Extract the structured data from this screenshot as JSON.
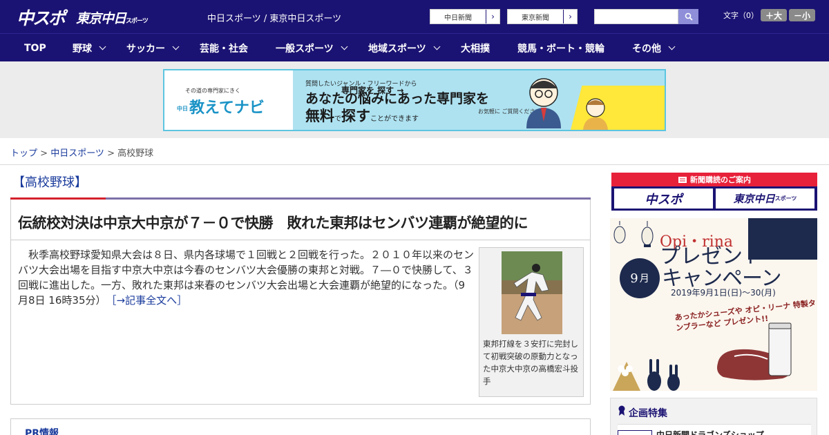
{
  "header": {
    "logo_chuspo": "中スポ",
    "logo_tokyo": "東京中日",
    "logo_tokyo_sub": "スポーツ",
    "site_title": "中日スポーツ / 東京中日スポーツ",
    "links": [
      {
        "label": "中日新聞"
      },
      {
        "label": "東京新聞"
      }
    ],
    "search": {
      "value": "",
      "placeholder": ""
    },
    "font_size_label": "文字（0）",
    "font_larger": "＋大",
    "font_smaller": "－小"
  },
  "nav": {
    "items": [
      {
        "label": "TOP"
      },
      {
        "label": "野球"
      },
      {
        "label": "サッカー"
      },
      {
        "label": "芸能・社会"
      },
      {
        "label": "一般スポーツ"
      },
      {
        "label": "地域スポーツ"
      },
      {
        "label": "大相撲"
      },
      {
        "label": "競馬・ボート・競輪"
      },
      {
        "label": "その他"
      }
    ]
  },
  "ad": {
    "sub": "その道の専門家にきく",
    "brand_prefix": "中日",
    "brand": "教えてナビ",
    "line1": "質問したいジャンル・フリーワードから",
    "line2": "あなたの悩みにあった専門家を",
    "line3_a": "無料",
    "line3_b": "で",
    "line3_c": "探す",
    "line3_d": "ことができます",
    "note": "お気軽に ご質問ください！",
    "cta": "専門家を 探す →"
  },
  "breadcrumb": {
    "home": "トップ",
    "sep": " > ",
    "section": "中日スポーツ",
    "current": "高校野球"
  },
  "article": {
    "section_title": "【高校野球】",
    "headline": "伝統校対決は中京大中京が７－０で快勝　敗れた東邦はセンバツ連覇が絶望的に",
    "lead": "秋季高校野球愛知県大会は８日、県内各球場で１回戦と２回戦を行った。２０１０年以来のセンバツ大会出場を目指す中京大中京は今春のセンバツ大会優勝の東邦と対戦。７―０で快勝して、３回戦に進出した。一方、敗れた東邦は来春のセンバツ大会出場と大会連覇が絶望的になった。（9月8日 16時35分）",
    "more_link": "［→記事全文へ］",
    "photo_caption": "東邦打線を３安打に完封して初戦突破の原動力となった中京大中京の高橋宏斗投手",
    "pr_label": "PR情報"
  },
  "sidebar": {
    "subscribe_title": "新聞購読のご案内",
    "subscribe_left": "中スポ",
    "subscribe_right": "東京中日",
    "subscribe_right_sub": "スポーツ",
    "promo": {
      "brand": "Opi・rina",
      "title1": "プレゼント",
      "title2": "キャンペーン",
      "month_num": "9",
      "month_unit": "月",
      "dates": "2019年9月1日(日)〜30(月)",
      "gift": "あったかシューズや オピ・リーナ 特製タンブラーなど プレゼント!!"
    },
    "kikaku_title": "企画特集",
    "kikaku_item": "中日新聞ドラゴンズショップ"
  },
  "colors": {
    "header_bg": "#1b1373",
    "accent_red": "#d4202c",
    "link_blue": "#1a3b9c",
    "ad_border": "#5cc5e0"
  }
}
